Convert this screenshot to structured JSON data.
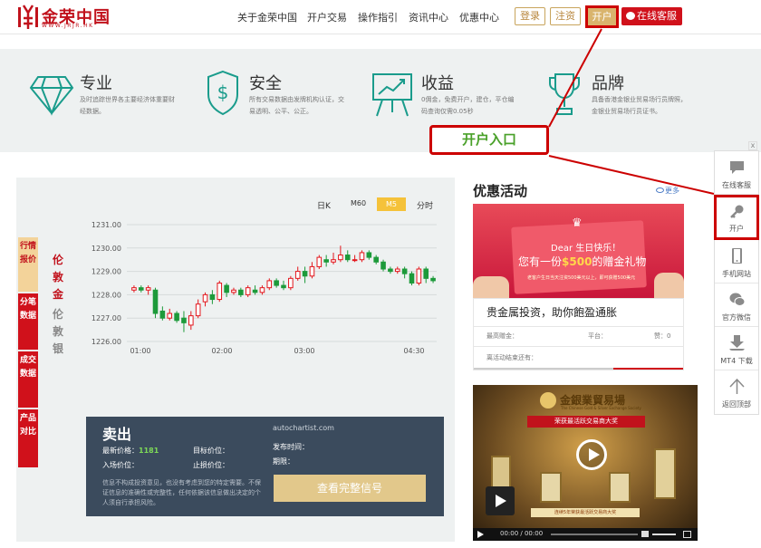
{
  "header": {
    "logo_text": "金荣中国",
    "logo_url": "WWW.JRJR.HK",
    "nav": [
      "关于金荣中国",
      "开户交易",
      "操作指引",
      "资讯中心",
      "优惠中心"
    ],
    "login_label": "登录",
    "register_label": "注资",
    "open_account_label": "开户",
    "online_service_label": "在线客服",
    "colors": {
      "brand_red": "#c1121c",
      "gold": "#d9b46d"
    }
  },
  "features": [
    {
      "icon": "diamond-icon",
      "title": "专业",
      "desc": "及时追踪世界各主要经济体重要财经数据。"
    },
    {
      "icon": "shield-dollar-icon",
      "title": "安全",
      "desc": "所有交易数据由发牌机构认证，交易透明、公平、公正。"
    },
    {
      "icon": "chart-board-icon",
      "title": "收益",
      "desc": "0佣金，免费开户，建仓，平仓编码查询仅需0.05秒"
    },
    {
      "icon": "trophy-icon",
      "title": "品牌",
      "desc": "具备香港金银业贸易场行员牌照，金银业贸易场行员证书。"
    }
  ],
  "callout": {
    "label": "开户入口",
    "color": "#c00"
  },
  "chart_panel": {
    "side_tabs": [
      "行情报价",
      "分笔数据",
      "成交数据",
      "产品对比"
    ],
    "products": [
      "伦敦金",
      "伦敦银"
    ],
    "timeframes": [
      "日K",
      "M60",
      "M5",
      "分时"
    ],
    "active_timeframe": "M5"
  },
  "chart_data": {
    "type": "candlestick",
    "y_ticks": [
      "1231.00",
      "1230.00",
      "1229.00",
      "1228.00",
      "1227.00",
      "1226.00"
    ],
    "x_ticks": [
      "01:00",
      "02:00",
      "03:00",
      "04:30"
    ],
    "ylim": [
      1226.0,
      1231.0
    ],
    "candles": [
      [
        1228.2,
        1228.3,
        1228.4,
        1228.1
      ],
      [
        1228.3,
        1228.2,
        1228.4,
        1228.1
      ],
      [
        1228.2,
        1228.3,
        1228.4,
        1228.0
      ],
      [
        1228.2,
        1227.2,
        1228.3,
        1227.0
      ],
      [
        1227.3,
        1227.0,
        1227.5,
        1226.9
      ],
      [
        1227.0,
        1227.2,
        1227.4,
        1226.9
      ],
      [
        1227.2,
        1226.9,
        1227.3,
        1226.8
      ],
      [
        1227.0,
        1226.8,
        1227.3,
        1226.4
      ],
      [
        1226.7,
        1227.1,
        1227.3,
        1226.5
      ],
      [
        1227.1,
        1227.6,
        1227.8,
        1227.0
      ],
      [
        1227.7,
        1228.0,
        1228.1,
        1227.5
      ],
      [
        1228.0,
        1227.8,
        1228.2,
        1227.6
      ],
      [
        1227.8,
        1228.5,
        1228.6,
        1227.7
      ],
      [
        1228.4,
        1228.1,
        1228.5,
        1227.9
      ],
      [
        1228.1,
        1228.2,
        1228.3,
        1228.0
      ],
      [
        1228.2,
        1228.0,
        1228.3,
        1227.9
      ],
      [
        1228.0,
        1228.3,
        1228.4,
        1227.9
      ],
      [
        1228.2,
        1228.1,
        1228.4,
        1228.0
      ],
      [
        1228.1,
        1228.3,
        1228.4,
        1228.0
      ],
      [
        1228.3,
        1228.6,
        1228.7,
        1228.2
      ],
      [
        1228.6,
        1228.4,
        1228.7,
        1228.3
      ],
      [
        1228.4,
        1228.3,
        1228.6,
        1228.2
      ],
      [
        1228.3,
        1228.7,
        1228.8,
        1228.2
      ],
      [
        1228.7,
        1229.0,
        1229.2,
        1228.6
      ],
      [
        1229.0,
        1228.8,
        1229.2,
        1228.5
      ],
      [
        1228.8,
        1229.2,
        1229.4,
        1228.7
      ],
      [
        1229.2,
        1229.6,
        1229.7,
        1229.1
      ],
      [
        1229.5,
        1229.4,
        1229.7,
        1229.2
      ],
      [
        1229.4,
        1229.5,
        1229.8,
        1229.3
      ],
      [
        1229.5,
        1229.7,
        1230.1,
        1229.4
      ],
      [
        1229.7,
        1229.5,
        1229.9,
        1229.4
      ],
      [
        1229.5,
        1229.5,
        1229.7,
        1229.4
      ],
      [
        1229.5,
        1229.8,
        1229.9,
        1229.4
      ],
      [
        1229.8,
        1229.6,
        1229.9,
        1229.5
      ],
      [
        1229.6,
        1229.4,
        1229.7,
        1229.3
      ],
      [
        1229.4,
        1229.1,
        1229.5,
        1229.0
      ],
      [
        1229.1,
        1229.0,
        1229.2,
        1228.9
      ],
      [
        1229.0,
        1229.1,
        1229.2,
        1228.9
      ],
      [
        1229.1,
        1228.9,
        1229.2,
        1228.7
      ],
      [
        1228.9,
        1228.5,
        1229.0,
        1228.4
      ],
      [
        1228.5,
        1229.1,
        1229.2,
        1228.4
      ],
      [
        1229.1,
        1228.7,
        1229.2,
        1228.5
      ],
      [
        1228.7,
        1228.6,
        1228.8,
        1228.5
      ]
    ],
    "colors": {
      "up": "#e3161c",
      "down": "#1d9a3a"
    }
  },
  "signal": {
    "title": "卖出",
    "latest_price_label": "最新价格：",
    "latest_price": "1181",
    "target_label": "目标价位：",
    "entry_label": "入场价位：",
    "stop_label": "止损价位：",
    "publish_label": "发布时间：",
    "period_label": "期限：",
    "disclaimer": "信息不构成投资意见，也没有考虑到您的特定需要。不保证信息的准确性或完整性，任何依据该信息做出决定的个人须自行承担风险。",
    "source_logo": "autochartist.com",
    "button_label": "查看完整信号"
  },
  "promo": {
    "heading": "优惠活动",
    "more_label": "更多",
    "banner1": {
      "greeting": "Dear 生日快乐！",
      "line1_pre": "您有一份",
      "line1_amount": "$500",
      "line1_post": "的赠金礼物",
      "small": "老客户生日当天注资500美元以上，即可获赠500美元"
    },
    "card_title": "贵金属投资，助你飽盈通胀",
    "bonus_label": "最高赠金：",
    "platform_label": "平台：",
    "likes_label": "赞：",
    "likes": "0",
    "countdown_label": "离活动结束还有：",
    "banner2": {
      "title": "金銀業貿易場",
      "subtitle": "The Chinese Gold & Silver Exchange Society",
      "ribbon": "荣获最活跃交易商大奖",
      "caption": "连续5年荣获最活跃交易商大奖",
      "time": "00:00 / 00:00"
    }
  },
  "floatbar": {
    "close_label": "x",
    "items": [
      {
        "icon": "chat-bubble-icon",
        "label": "在线客服"
      },
      {
        "icon": "key-icon",
        "label": "开户"
      },
      {
        "icon": "phone-icon",
        "label": "手机网站"
      },
      {
        "icon": "wechat-icon",
        "label": "官方微信"
      },
      {
        "icon": "download-icon",
        "label": "MT4 下载"
      },
      {
        "icon": "arrow-up-icon",
        "label": "返回顶部"
      }
    ]
  }
}
